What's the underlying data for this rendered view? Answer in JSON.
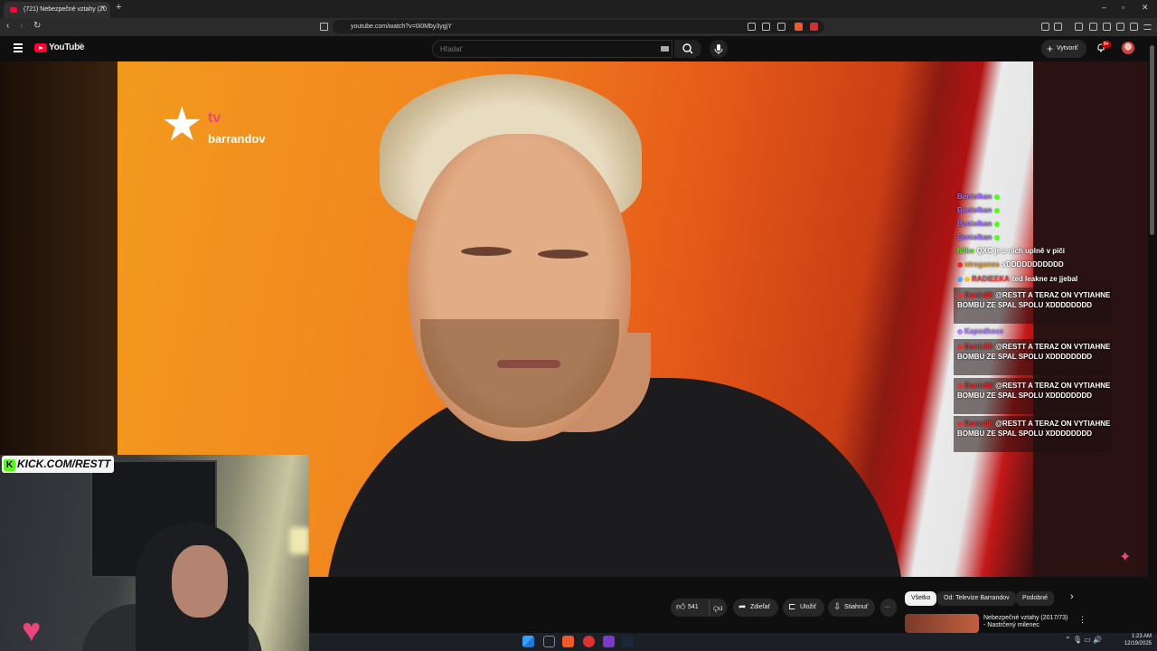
{
  "browser": {
    "tab_title": "(721) Nebezpečné vztahy (20",
    "url": "youtube.com/watch?v=0i0Mby3ygjY",
    "new_tab": "+",
    "tab_close": "×",
    "win_min": "–",
    "win_max": "▫",
    "win_close": "✕",
    "back": "‹",
    "forward": "›",
    "reload": "↻"
  },
  "youtube": {
    "logo_text": "YouTube",
    "country_code": "SK",
    "search_placeholder": "Hľadať",
    "create_label": "Vytvoriť",
    "notification_count": "9+"
  },
  "video": {
    "channel_logo_tv": "tv",
    "channel_logo_name": "barrandov"
  },
  "stream_overlay": {
    "kick_label": "KICK.COM/RESTT",
    "kick_letter": "K"
  },
  "chat": {
    "messages": [
      {
        "user": "Beniolkan",
        "text": "",
        "user_color": "#9b6cf0"
      },
      {
        "user": "Beniolkan",
        "text": "",
        "user_color": "#9b6cf0"
      },
      {
        "user": "Beniolkan",
        "text": "",
        "user_color": "#9b6cf0"
      },
      {
        "user": "Beniolkan",
        "text": "",
        "user_color": "#9b6cf0"
      },
      {
        "user": "h3ko",
        "text": "QXC je z nich uplně v piči",
        "user_color": "#53fc18"
      },
      {
        "user": "stroganos",
        "text": "xDDDDDDDDDDD",
        "user_color": "#e0a040"
      },
      {
        "user": "RADIEEKA",
        "text": "ted leakne ze jjebal",
        "user_color": "#ff3b3b"
      },
      {
        "user": "Dunix88",
        "text": "@RESTT A TERAZ ON VYTIAHNE BOMBU ZE SPAL SPOLU XDDDDDDDD",
        "user_color": "#e03030"
      },
      {
        "user": "Kapodkoce",
        "text": "",
        "user_color": "#b080ff"
      },
      {
        "user": "Dunix88",
        "text": "@RESTT A TERAZ ON VYTIAHNE BOMBU ZE SPAL SPOLU XDDDDDDDD",
        "user_color": "#e03030"
      },
      {
        "user": "Dunix88",
        "text": "@RESTT A TERAZ ON VYTIAHNE BOMBU ZE SPAL SPOLU XDDDDDDDD",
        "user_color": "#e03030"
      },
      {
        "user": "Dunix88",
        "text": "@RESTT A TERAZ ON VYTIAHNE BOMBU ZE SPAL SPOLU XDDDDDDDD",
        "user_color": "#e03030"
      }
    ]
  },
  "actions": {
    "likes": "541",
    "share": "Zdieľať",
    "save": "Uložiť",
    "download": "Stiahnuť",
    "more": "···"
  },
  "chips": {
    "all": "Všetko",
    "from_channel": "Od: Televize Barrandov",
    "similar": "Podobné",
    "next": "›"
  },
  "recommended": {
    "title": "Nebezpečné vztahy (2017/73) - Nastrčený milenec",
    "more": "⋮"
  },
  "taskbar": {
    "time": "1:23 AM",
    "date": "12/19/2025",
    "tray": "⌃ 🎙 ▭ 🔊"
  },
  "colors": {
    "youtube_red": "#ff0033",
    "kick_green": "#53fc18",
    "barrandov_pink": "#e8497a"
  }
}
